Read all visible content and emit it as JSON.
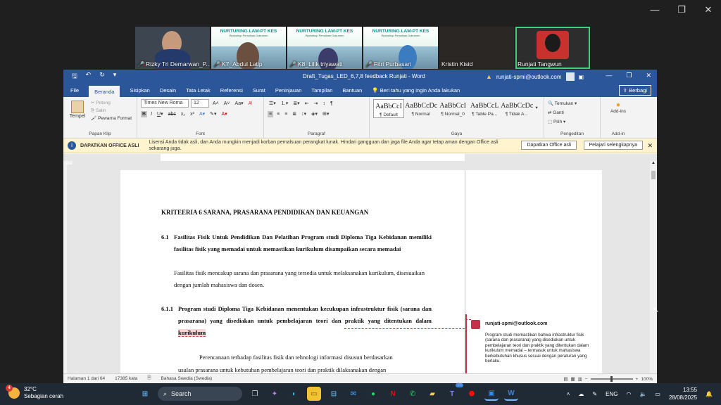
{
  "meeting": {
    "participants": [
      {
        "name": "Rizky Tri Demarwan_P...",
        "muted": true
      },
      {
        "name": "K7_Abdul Latip",
        "muted": true,
        "banner": "NURTURING LAM-PT KES",
        "banner_sub": "Workshop Penulisan Dokumen"
      },
      {
        "name": "K8_Lilik triyawati",
        "muted": true,
        "banner": "NURTURING LAM-PT KES",
        "banner_sub": "Workshop Penulisan Dokumen"
      },
      {
        "name": "Fitri Purbasari",
        "muted": true,
        "banner": "NURTURING LAM-PT KES",
        "banner_sub": "Workshop Penulisan Dokumen"
      },
      {
        "name": "Kristin Kisid",
        "muted": false
      },
      {
        "name": "Runjati Tangwun",
        "muted": true,
        "active": true
      }
    ]
  },
  "word": {
    "doc_title": "Draft_Tugas_LED_6,7,8 feedback Runjati - Word",
    "account": "runjati-spmi@outlook.com",
    "tabs": [
      "File",
      "Beranda",
      "Sisipkan",
      "Desain",
      "Tata Letak",
      "Referensi",
      "Surat",
      "Peninjauan",
      "Tampilan",
      "Bantuan"
    ],
    "tell_me": "Beri tahu yang ingin Anda lakukan",
    "share": "Berbagi",
    "ribbon": {
      "clipboard": {
        "paste": "Tempel",
        "cut": "Potong",
        "copy": "Salin",
        "format_painter": "Pewarna Format",
        "label": "Papan Klip"
      },
      "font": {
        "name": "Times New Roma",
        "size": "12",
        "label": "Font"
      },
      "paragraph": {
        "label": "Paragraf"
      },
      "styles": {
        "items": [
          {
            "preview": "AaBbCcI",
            "name": "¶ Default"
          },
          {
            "preview": "AaBbCcDc",
            "name": "¶ Normal"
          },
          {
            "preview": "AaBbCcI",
            "name": "¶ Normal_0"
          },
          {
            "preview": "AaBbCcL",
            "name": "¶ Table Pa..."
          },
          {
            "preview": "AaBbCcDc",
            "name": "¶ Tidak A..."
          }
        ],
        "label": "Gaya"
      },
      "editing": {
        "find": "Temukan",
        "replace": "Ganti",
        "select": "Pilih",
        "label": "Pengeditan"
      },
      "addins": {
        "item": "Add-ins",
        "label": "Add-in"
      }
    },
    "infobar": {
      "title": "DAPATKAN OFFICE ASLI",
      "text": "Lisensi Anda tidak asli, dan Anda mungkin menjadi korban pemalsuan perangkat lunak. Hindari gangguan dan jaga file Anda agar tetap aman dengan Office asli sekarang juga.",
      "btn_primary": "Dapatkan Office asli",
      "btn_secondary": "Pelajari selengkapnya"
    },
    "document": {
      "title": "KRITEERIA 6 SARANA, PRASARANA PENDIDIKAN DAN KEUANGAN",
      "s61_num": "6.1",
      "s61_head": "Fasilitas Fisik Untuk Pendidikan Dan Pelatihan Program studi Diploma Tiga Kebidanan memiliki fasilitas fisik yang memadai untuk memastikan kurikulum disampaikan secara memadai",
      "s61_body": "Fasilitas fisik mencakup sarana dan prasarana yang tersedia untuk melaksanakan kurikulum, disesuaikan dengan jumlah mahasiswa dan dosen.",
      "s611_num": "6.1.1",
      "s611_head_a": "Program studi Diploma Tiga Kebidanan menentukan kecukupan infrastruktur fisik (sarana dan prasarana) yang disediakan untuk pembelajaran teori dan praktik yang ditentukan dalam",
      "s611_head_hl": "kurikulum",
      "p1": "Perencanaan terhadap fasilitas fisik dan tehnologi informasi disusun berdasarkan",
      "p2": "usulan   prasarana untuk kebutuhan pembelajaran teori dan praktik dilaksanakan dengan"
    },
    "comment": {
      "author": "runjati-spmi@outlook.com",
      "text": "Program studi memastikan bahwa infrastruktur fisik (sarana dan prasarana) yang disediakan untuk pembelajaran teori dan praktik yang ditentukan dalam kurikulum memadai – termasuk untuk mahasiswa berkebutuhan khusus sesuai dengan peraturan yang berlaku."
    },
    "status": {
      "page": "Halaman 1 dari 64",
      "words": "17385 kata",
      "language": "Bahasa Swedia (Swedia)",
      "zoom": "100%",
      "zoom_level": 0.5
    }
  },
  "taskbar": {
    "temp": "32°C",
    "weather": "Sebagian cerah",
    "weather_badge": "4",
    "search": "Search",
    "badge_count": "54",
    "lang": "ENG",
    "time": "13:55",
    "date": "28/08/2025"
  }
}
